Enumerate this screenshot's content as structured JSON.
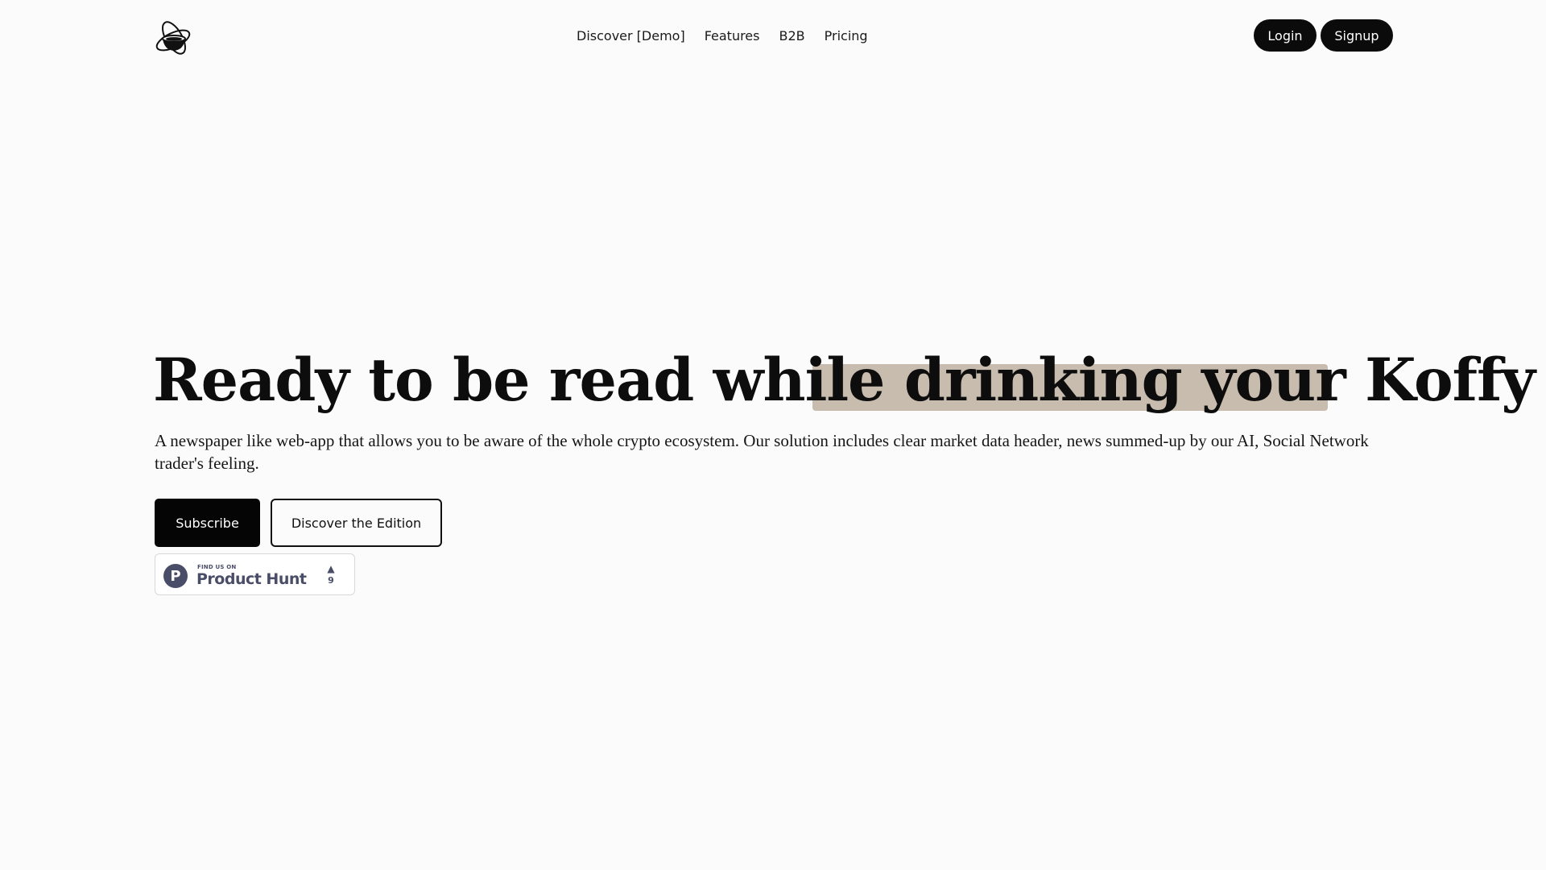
{
  "header": {
    "logo_icon": "coffee-orbit-logo-icon",
    "nav": [
      {
        "label": "Discover [Demo]"
      },
      {
        "label": "Features"
      },
      {
        "label": "B2B"
      },
      {
        "label": "Pricing"
      }
    ],
    "login_label": "Login",
    "signup_label": "Signup"
  },
  "hero": {
    "title_prefix": "Ready to be read while d",
    "title_highlight": "rinking your Koffy",
    "description": "A newspaper like web-app that allows you to be aware of the whole crypto ecosystem. Our solution includes clear market data header, news summed-up by our AI, Social Network trader's feeling.",
    "subscribe_label": "Subscribe",
    "discover_label": "Discover the Edition",
    "highlight_color": "#c8bcae"
  },
  "product_hunt": {
    "find_us": "FIND US ON",
    "name": "Product Hunt",
    "logo_letter": "P",
    "upvote_arrow": "▲",
    "upvotes": "9",
    "brand_color": "#4a4d68"
  }
}
